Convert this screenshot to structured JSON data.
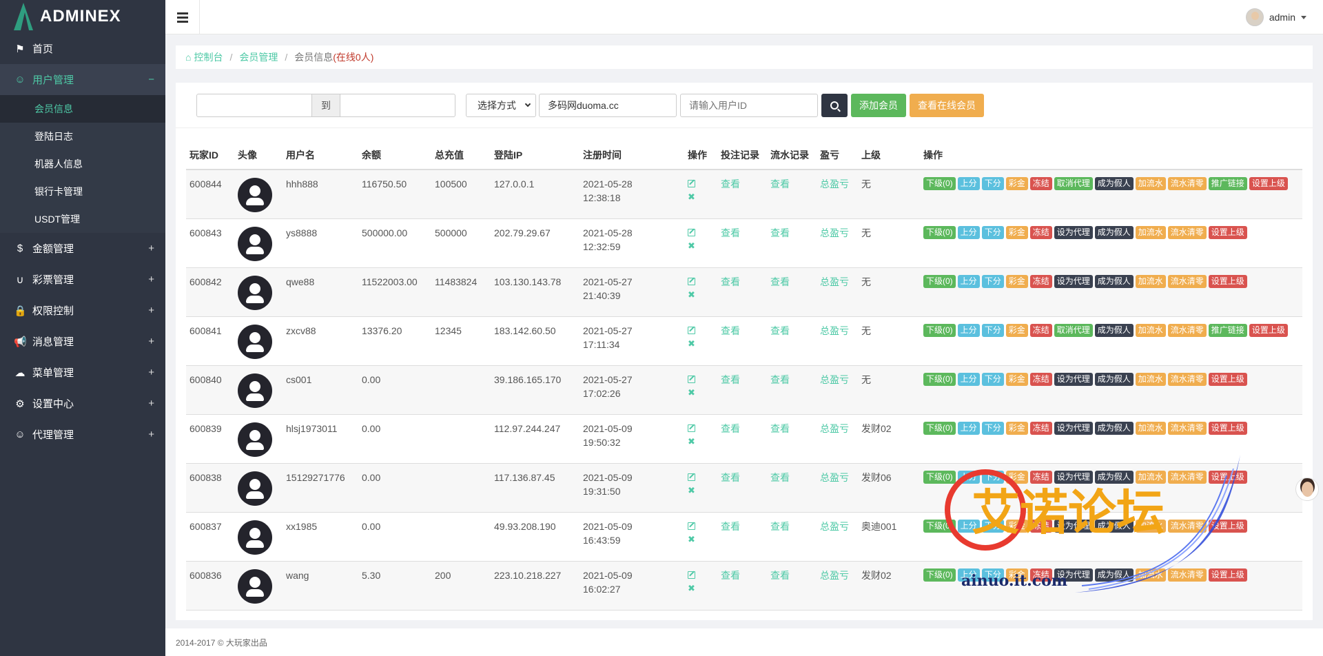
{
  "brand": {
    "name_pre": "ADMIN",
    "name_x": "EX"
  },
  "sidebar": {
    "items": [
      {
        "label": "首页",
        "icon": "flag-icon"
      },
      {
        "label": "用户管理",
        "icon": "smile-icon",
        "open": true,
        "children": [
          "会员信息",
          "登陆日志",
          "机器人信息",
          "银行卡管理",
          "USDT管理"
        ]
      },
      {
        "label": "金额管理",
        "icon": "dollar-icon"
      },
      {
        "label": "彩票管理",
        "icon": "magnet-icon"
      },
      {
        "label": "权限控制",
        "icon": "lock-icon"
      },
      {
        "label": "消息管理",
        "icon": "bullhorn-icon"
      },
      {
        "label": "菜单管理",
        "icon": "cloud-icon"
      },
      {
        "label": "设置中心",
        "icon": "gear-icon"
      },
      {
        "label": "代理管理",
        "icon": "smile-icon"
      }
    ],
    "open_symbol": "−",
    "closed_symbol": "+"
  },
  "topbar": {
    "user": "admin"
  },
  "breadcrumb": {
    "home": "控制台",
    "section": "会员管理",
    "current": "会员信息",
    "online": "(在线0人)"
  },
  "filter": {
    "to_label": "到",
    "select_value": "选择方式",
    "site_value": "多码网duoma.cc",
    "uid_placeholder": "请输入用户ID",
    "add_label": "添加会员",
    "online_label": "查看在线会员"
  },
  "table": {
    "headers": [
      "玩家ID",
      "头像",
      "用户名",
      "余额",
      "总充值",
      "登陆IP",
      "注册时间",
      "操作",
      "投注记录",
      "流水记录",
      "盈亏",
      "上级",
      "操作"
    ],
    "view_label": "查看",
    "pl_label": "总盈亏",
    "rows": [
      {
        "id": "600844",
        "user": "hhh888",
        "balance": "116750.50",
        "recharge": "100500",
        "ip": "127.0.0.1",
        "date": "2021-05-28",
        "time": "12:38:18",
        "parent": "无",
        "ops": [
          [
            "下级(0)",
            "green"
          ],
          [
            "上分",
            "blue"
          ],
          [
            "下分",
            "blue"
          ],
          [
            "彩金",
            "orange"
          ],
          [
            "冻结",
            "red"
          ],
          [
            "取消代理",
            "green"
          ],
          [
            "成为假人",
            "dark"
          ],
          [
            "加流水",
            "orange"
          ],
          [
            "流水清零",
            "orange"
          ],
          [
            "推广链接",
            "green"
          ],
          [
            "设置上级",
            "red"
          ]
        ]
      },
      {
        "id": "600843",
        "user": "ys8888",
        "balance": "500000.00",
        "recharge": "500000",
        "ip": "202.79.29.67",
        "date": "2021-05-28",
        "time": "12:32:59",
        "parent": "无",
        "ops": [
          [
            "下级(0)",
            "green"
          ],
          [
            "上分",
            "blue"
          ],
          [
            "下分",
            "blue"
          ],
          [
            "彩金",
            "orange"
          ],
          [
            "冻结",
            "red"
          ],
          [
            "设为代理",
            "dark"
          ],
          [
            "成为假人",
            "dark"
          ],
          [
            "加流水",
            "orange"
          ],
          [
            "流水清零",
            "orange"
          ],
          [
            "设置上级",
            "red"
          ]
        ]
      },
      {
        "id": "600842",
        "user": "qwe88",
        "balance": "11522003.00",
        "recharge": "11483824",
        "ip": "103.130.143.78",
        "date": "2021-05-27",
        "time": "21:40:39",
        "parent": "无",
        "ops": [
          [
            "下级(0)",
            "green"
          ],
          [
            "上分",
            "blue"
          ],
          [
            "下分",
            "blue"
          ],
          [
            "彩金",
            "orange"
          ],
          [
            "冻结",
            "red"
          ],
          [
            "设为代理",
            "dark"
          ],
          [
            "成为假人",
            "dark"
          ],
          [
            "加流水",
            "orange"
          ],
          [
            "流水清零",
            "orange"
          ],
          [
            "设置上级",
            "red"
          ]
        ]
      },
      {
        "id": "600841",
        "user": "zxcv88",
        "balance": "13376.20",
        "recharge": "12345",
        "ip": "183.142.60.50",
        "date": "2021-05-27",
        "time": "17:11:34",
        "parent": "无",
        "ops": [
          [
            "下级(0)",
            "green"
          ],
          [
            "上分",
            "blue"
          ],
          [
            "下分",
            "blue"
          ],
          [
            "彩金",
            "orange"
          ],
          [
            "冻结",
            "red"
          ],
          [
            "取消代理",
            "green"
          ],
          [
            "成为假人",
            "dark"
          ],
          [
            "加流水",
            "orange"
          ],
          [
            "流水清零",
            "orange"
          ],
          [
            "推广链接",
            "green"
          ],
          [
            "设置上级",
            "red"
          ]
        ]
      },
      {
        "id": "600840",
        "user": "cs001",
        "balance": "0.00",
        "recharge": "",
        "ip": "39.186.165.170",
        "date": "2021-05-27",
        "time": "17:02:26",
        "parent": "无",
        "ops": [
          [
            "下级(0)",
            "green"
          ],
          [
            "上分",
            "blue"
          ],
          [
            "下分",
            "blue"
          ],
          [
            "彩金",
            "orange"
          ],
          [
            "冻结",
            "red"
          ],
          [
            "设为代理",
            "dark"
          ],
          [
            "成为假人",
            "dark"
          ],
          [
            "加流水",
            "orange"
          ],
          [
            "流水清零",
            "orange"
          ],
          [
            "设置上级",
            "red"
          ]
        ]
      },
      {
        "id": "600839",
        "user": "hlsj1973011",
        "balance": "0.00",
        "recharge": "",
        "ip": "112.97.244.247",
        "date": "2021-05-09",
        "time": "19:50:32",
        "parent": "发财02",
        "ops": [
          [
            "下级(0)",
            "green"
          ],
          [
            "上分",
            "blue"
          ],
          [
            "下分",
            "blue"
          ],
          [
            "彩金",
            "orange"
          ],
          [
            "冻结",
            "red"
          ],
          [
            "设为代理",
            "dark"
          ],
          [
            "成为假人",
            "dark"
          ],
          [
            "加流水",
            "orange"
          ],
          [
            "流水清零",
            "orange"
          ],
          [
            "设置上级",
            "red"
          ]
        ]
      },
      {
        "id": "600838",
        "user": "15129271776",
        "balance": "0.00",
        "recharge": "",
        "ip": "117.136.87.45",
        "date": "2021-05-09",
        "time": "19:31:50",
        "parent": "发财06",
        "ops": [
          [
            "下级(0)",
            "green"
          ],
          [
            "上分",
            "blue"
          ],
          [
            "下分",
            "blue"
          ],
          [
            "彩金",
            "orange"
          ],
          [
            "冻结",
            "red"
          ],
          [
            "设为代理",
            "dark"
          ],
          [
            "成为假人",
            "dark"
          ],
          [
            "加流水",
            "orange"
          ],
          [
            "流水清零",
            "orange"
          ],
          [
            "设置上级",
            "red"
          ]
        ]
      },
      {
        "id": "600837",
        "user": "xx1985",
        "balance": "0.00",
        "recharge": "",
        "ip": "49.93.208.190",
        "date": "2021-05-09",
        "time": "16:43:59",
        "parent": "奥迪001",
        "ops": [
          [
            "下级(0)",
            "green"
          ],
          [
            "上分",
            "blue"
          ],
          [
            "下分",
            "blue"
          ],
          [
            "彩金",
            "orange"
          ],
          [
            "冻结",
            "red"
          ],
          [
            "设为代理",
            "dark"
          ],
          [
            "成为假人",
            "dark"
          ],
          [
            "加流水",
            "orange"
          ],
          [
            "流水清零",
            "orange"
          ],
          [
            "设置上级",
            "red"
          ]
        ]
      },
      {
        "id": "600836",
        "user": "wang",
        "balance": "5.30",
        "recharge": "200",
        "ip": "223.10.218.227",
        "date": "2021-05-09",
        "time": "16:02:27",
        "parent": "发财02",
        "ops": [
          [
            "下级(0)",
            "green"
          ],
          [
            "上分",
            "blue"
          ],
          [
            "下分",
            "blue"
          ],
          [
            "彩金",
            "orange"
          ],
          [
            "冻结",
            "red"
          ],
          [
            "设为代理",
            "dark"
          ],
          [
            "成为假人",
            "dark"
          ],
          [
            "加流水",
            "orange"
          ],
          [
            "流水清零",
            "orange"
          ],
          [
            "设置上级",
            "red"
          ]
        ]
      }
    ]
  },
  "footer": {
    "text": "2014-2017 © 大玩家出品"
  },
  "watermark": {
    "title": "艾诺论坛",
    "url": "ainuo.it.com"
  },
  "colors": {
    "accent": "#4ec9a6",
    "sidebar": "#2f3542",
    "green": "#5cb85c",
    "blue": "#5bc0de",
    "orange": "#f0ad4e",
    "red": "#d9534f",
    "dark": "#3a4150"
  }
}
